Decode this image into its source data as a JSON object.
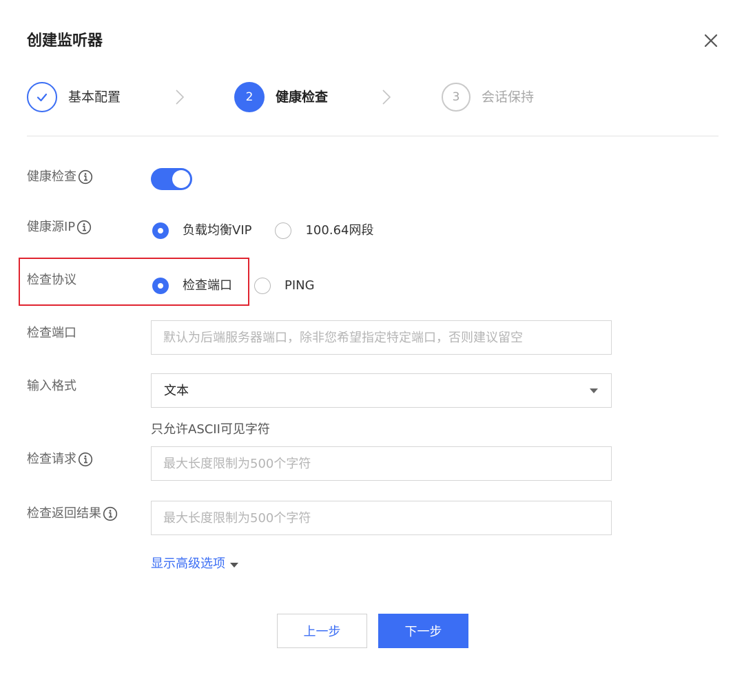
{
  "dialog": {
    "title": "创建监听器",
    "close_icon": "close-icon"
  },
  "steps": [
    {
      "number": "",
      "label": "基本配置",
      "status": "done",
      "icon": "check-icon"
    },
    {
      "number": "2",
      "label": "健康检查",
      "status": "active"
    },
    {
      "number": "3",
      "label": "会话保持",
      "status": "todo"
    }
  ],
  "form": {
    "health_check": {
      "label": "健康检查",
      "enabled": true
    },
    "health_source_ip": {
      "label": "健康源IP",
      "options": [
        "负载均衡VIP",
        "100.64网段"
      ],
      "selected": "负载均衡VIP"
    },
    "check_protocol": {
      "label": "检查协议",
      "options": [
        "检查端口",
        "PING"
      ],
      "selected": "检查端口"
    },
    "check_port": {
      "label": "检查端口",
      "value": "",
      "placeholder": "默认为后端服务器端口，除非您希望指定特定端口，否则建议留空"
    },
    "input_format": {
      "label": "输入格式",
      "value": "文本",
      "hint": "只允许ASCII可见字符"
    },
    "check_request": {
      "label": "检查请求",
      "value": "",
      "placeholder": "最大长度限制为500个字符"
    },
    "check_response": {
      "label": "检查返回结果",
      "value": "",
      "placeholder": "最大长度限制为500个字符"
    },
    "advanced_link": "显示高级选项"
  },
  "footer": {
    "prev_label": "上一步",
    "next_label": "下一步"
  },
  "colors": {
    "primary": "#3b6ef4",
    "highlight": "#e0242f"
  }
}
